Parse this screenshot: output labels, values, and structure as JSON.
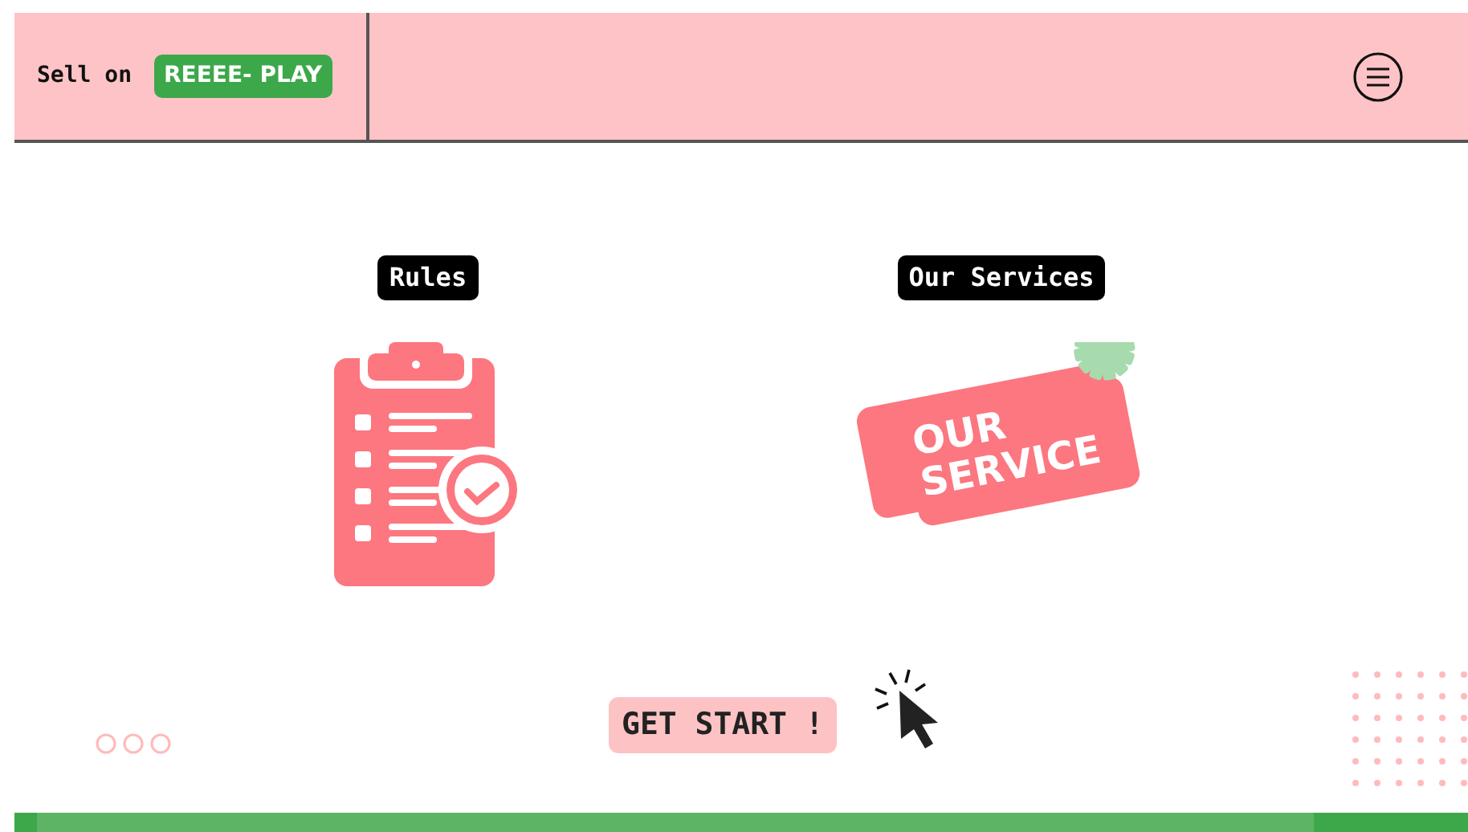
{
  "header": {
    "sell_label": "Sell on",
    "brand_badge": "REEEE- PLAY"
  },
  "sections": [
    {
      "kind": "rules",
      "title": "Rules"
    },
    {
      "kind": "services",
      "title": "Our Services",
      "art_lines": [
        "OUR",
        "SERVICE"
      ]
    }
  ],
  "cta": {
    "label": "GET START !"
  }
}
